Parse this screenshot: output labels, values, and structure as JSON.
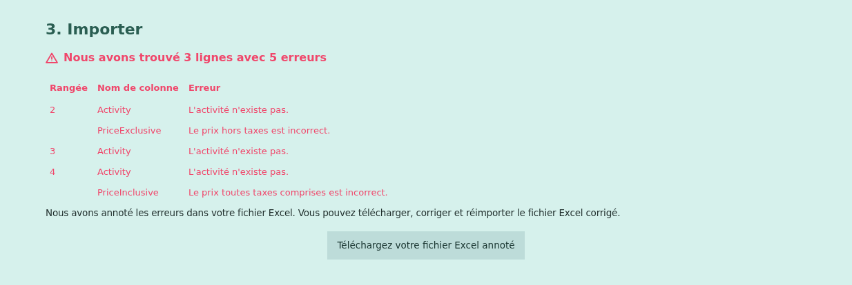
{
  "title": "3. Importer",
  "alert": "Nous avons trouvé 3 lignes avec 5 erreurs",
  "table": {
    "columns": [
      "Rangée",
      "Nom de colonne",
      "Erreur"
    ],
    "rows": [
      {
        "row": "2",
        "column": "Activity",
        "error": "L'activité n'existe pas."
      },
      {
        "column": "PriceExclusive",
        "error": "Le prix hors taxes est incorrect."
      },
      {
        "row": "3",
        "column": "Activity",
        "error": "L'activité n'existe pas."
      },
      {
        "row": "4",
        "column": "Activity",
        "error": "L'activité n'existe pas."
      },
      {
        "column": "PriceInclusive",
        "error": "Le prix toutes taxes comprises est incorrect."
      }
    ]
  },
  "note": "Nous avons annoté les erreurs dans votre fichier Excel. Vous pouvez télécharger, corriger et réimporter le fichier Excel corrigé.",
  "button": "Téléchargez votre fichier Excel annoté"
}
